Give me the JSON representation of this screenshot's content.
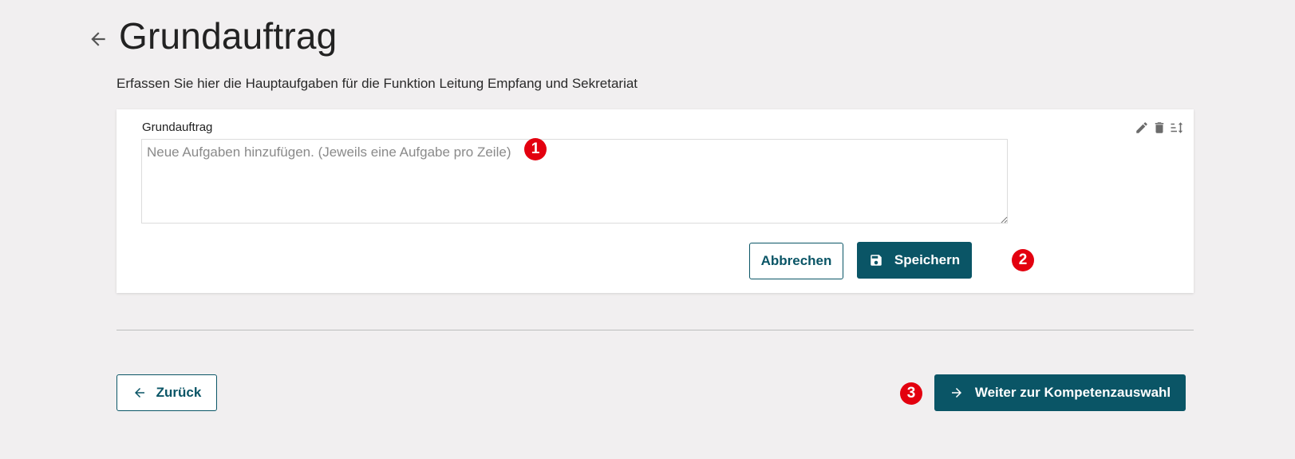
{
  "header": {
    "title": "Grundauftrag",
    "subtitle": "Erfassen Sie hier die Hauptaufgaben für die Funktion Leitung Empfang und Sekretariat"
  },
  "card": {
    "label": "Grundauftrag",
    "textarea_value": "",
    "textarea_placeholder": "Neue Aufgaben hinzufügen. (Jeweils eine Aufgabe pro Zeile)",
    "tools": [
      "pencil-icon",
      "trash-icon",
      "sort-icon"
    ],
    "cancel_label": "Abbrechen",
    "save_label": "Speichern"
  },
  "footer": {
    "back_label": "Zurück",
    "next_label": "Weiter zur Kompetenzauswahl"
  },
  "annotations": [
    "1",
    "2",
    "3"
  ],
  "colors": {
    "primary": "#0a5566",
    "background": "#f1eff0",
    "badge": "#e3000f"
  }
}
